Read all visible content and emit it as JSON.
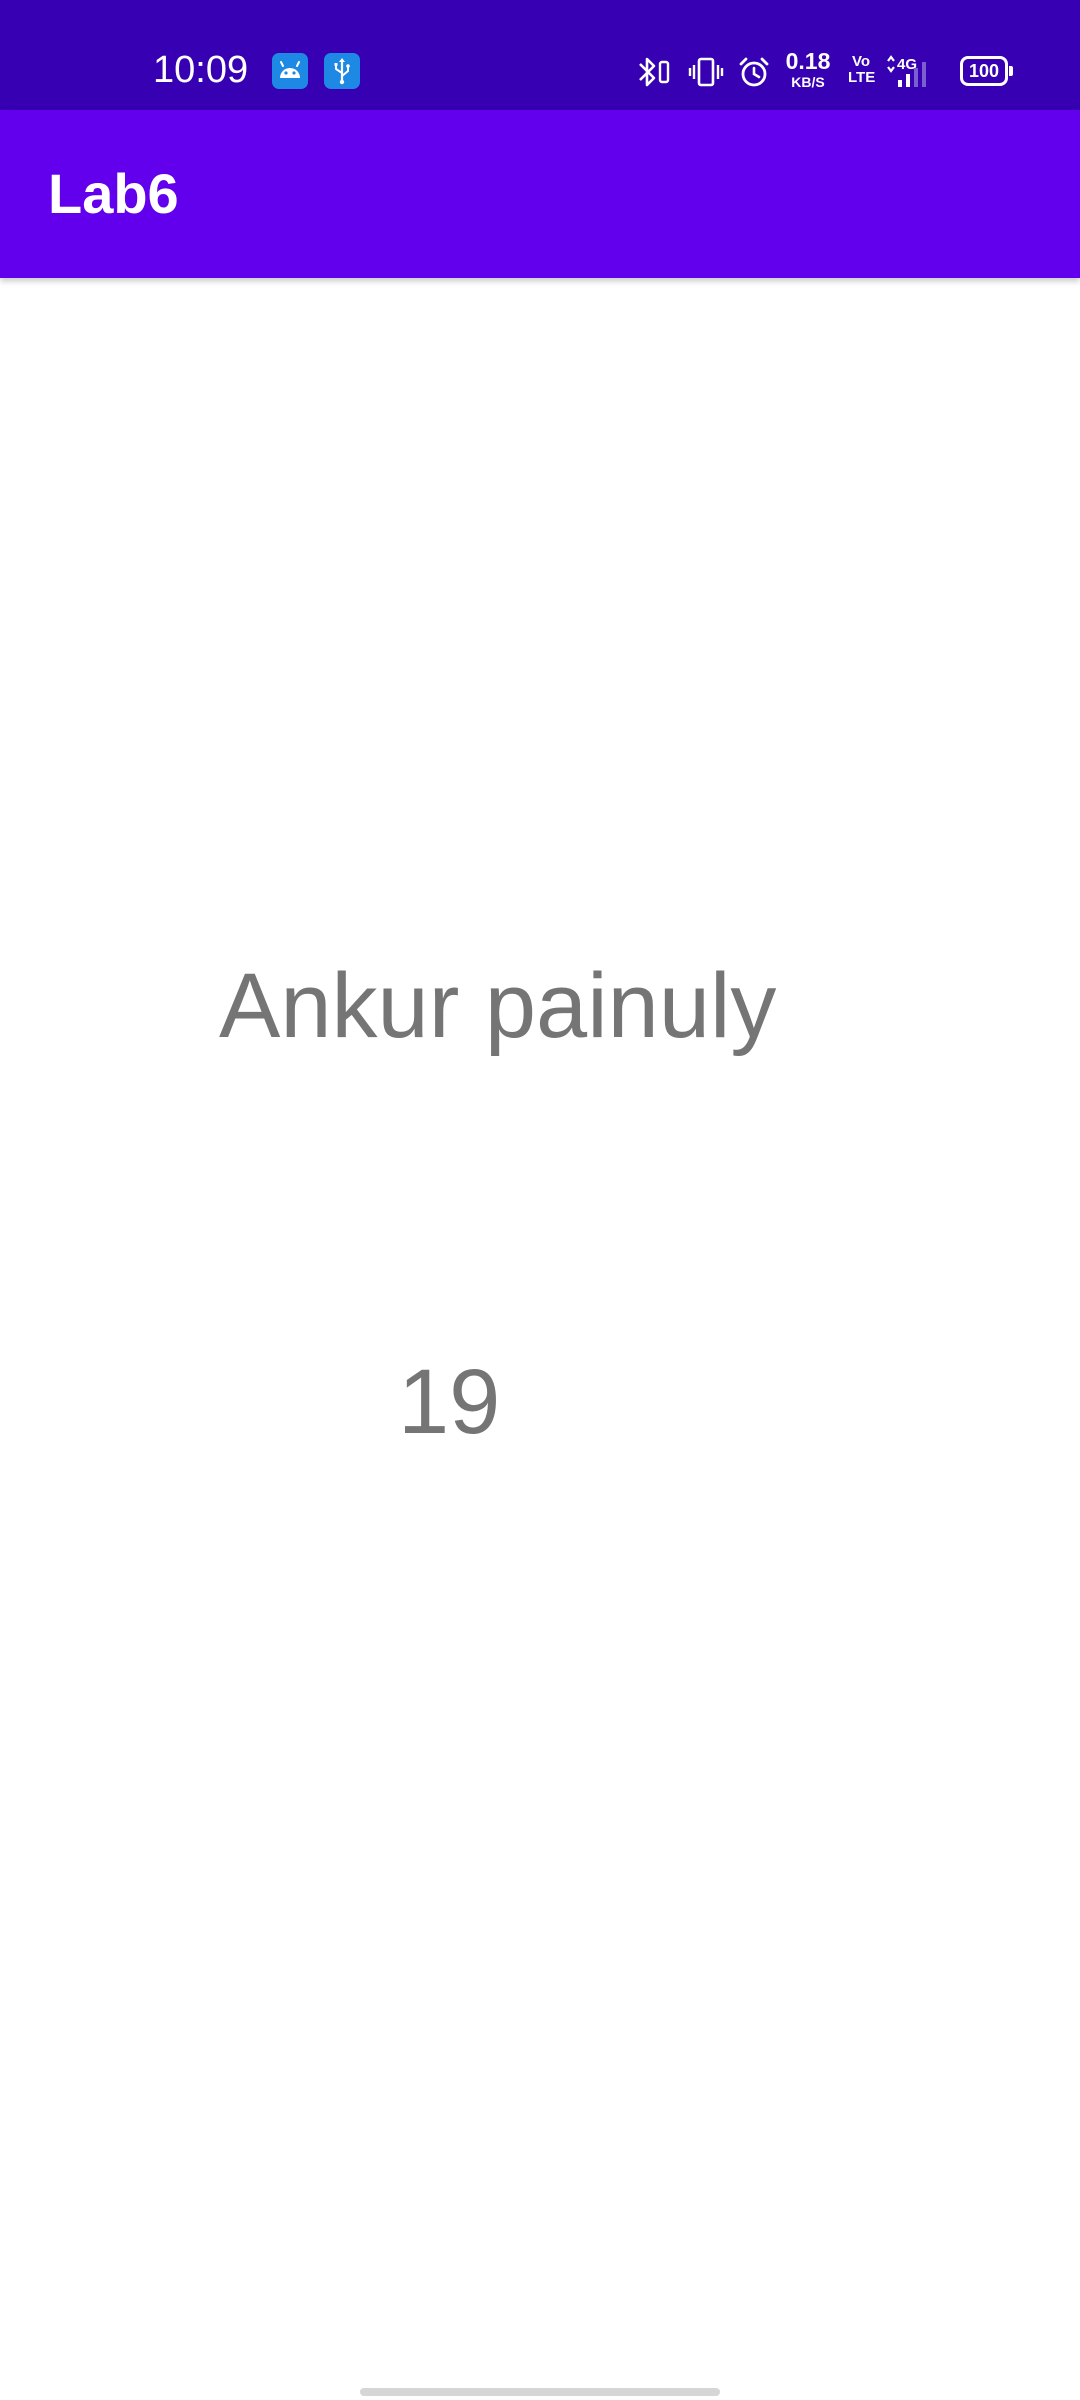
{
  "status_bar": {
    "time": "10:09",
    "net_speed_value": "0.18",
    "net_speed_unit": "KB/S",
    "volte_top": "Vo",
    "volte_bottom": "LTE",
    "network_type": "4G",
    "battery": "100",
    "background_color": "#3700B3",
    "notification_icons": [
      "android-icon",
      "usb-icon"
    ],
    "system_icons": [
      "bluetooth-icon",
      "vibrate-icon",
      "alarm-icon",
      "signal-icon",
      "battery-icon"
    ]
  },
  "app_bar": {
    "title": "Lab6",
    "background_color": "#6200EE"
  },
  "content": {
    "name": "Ankur painuly",
    "number": "19",
    "text_color": "#757575"
  }
}
